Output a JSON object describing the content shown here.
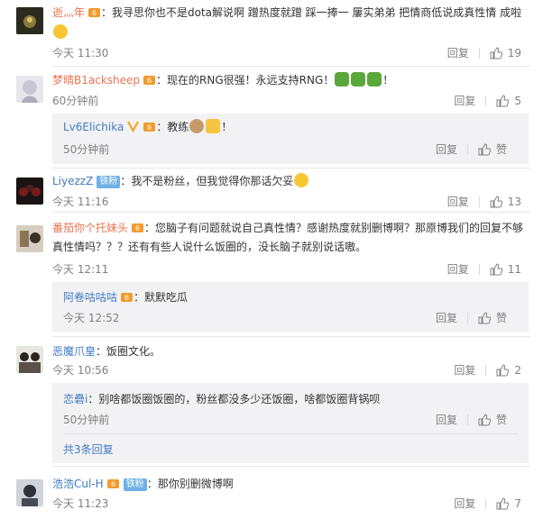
{
  "comments": [
    {
      "user": "逝灬年",
      "text": "：我寻思你也不是dota解说啊 蹭热度就蹭 踩一捧一 屢实弟弟 把情商低说成真性情 成啦",
      "time": "今天 11:30",
      "reply_label": "回复",
      "likes": "19"
    },
    {
      "user": "梦晴B1acksheep",
      "text": "：现在的RNG很强！永远支持RNG！",
      "time": "60分钟前",
      "reply_label": "回复",
      "likes": "5",
      "replies": [
        {
          "user": "Lv6Elichika",
          "text": "：教练",
          "time": "50分钟前",
          "reply_label": "回复",
          "like_label": "赞"
        }
      ]
    },
    {
      "user": "LiyezzZ",
      "badge": "铁粉",
      "text": "：我不是粉丝，但我觉得你那话欠妥",
      "time": "今天 11:16",
      "reply_label": "回复",
      "likes": "13"
    },
    {
      "user": "番茄你个托妹头",
      "text": "：您脑子有问题就说自己真性情？感谢热度就别删博啊？那原博我们的回复不够真性情吗？？？还有有些人说什么饭圈的，没长脑子就别说话嗷。",
      "time": "今天 12:11",
      "reply_label": "回复",
      "likes": "11",
      "replies": [
        {
          "user": "阿卷咕咕咕",
          "text": "：默默吃瓜",
          "time": "今天 12:52",
          "reply_label": "回复",
          "like_label": "赞"
        }
      ]
    },
    {
      "user": "恶魔爪皇",
      "text": "：饭圈文化。",
      "time": "今天 10:56",
      "reply_label": "回复",
      "likes": "2",
      "replies": [
        {
          "user": "恋礨i",
          "text": "：别啥都饭圈饭圈的，粉丝都没多少还饭圈，啥都饭圈背锅呗",
          "time": "50分钟前",
          "reply_label": "回复",
          "like_label": "赞"
        }
      ],
      "more_replies": "共3条回复"
    },
    {
      "user": "浩浩Cul-H",
      "badge": "铁粉",
      "text": "：那你别删微博啊",
      "time": "今天 11:23",
      "reply_label": "回复",
      "likes": "7"
    }
  ],
  "colors": {
    "username": "#eb7350",
    "reply_username": "#3e7ac2",
    "meta": "#808080",
    "subpanel": "#f2f2f5"
  }
}
